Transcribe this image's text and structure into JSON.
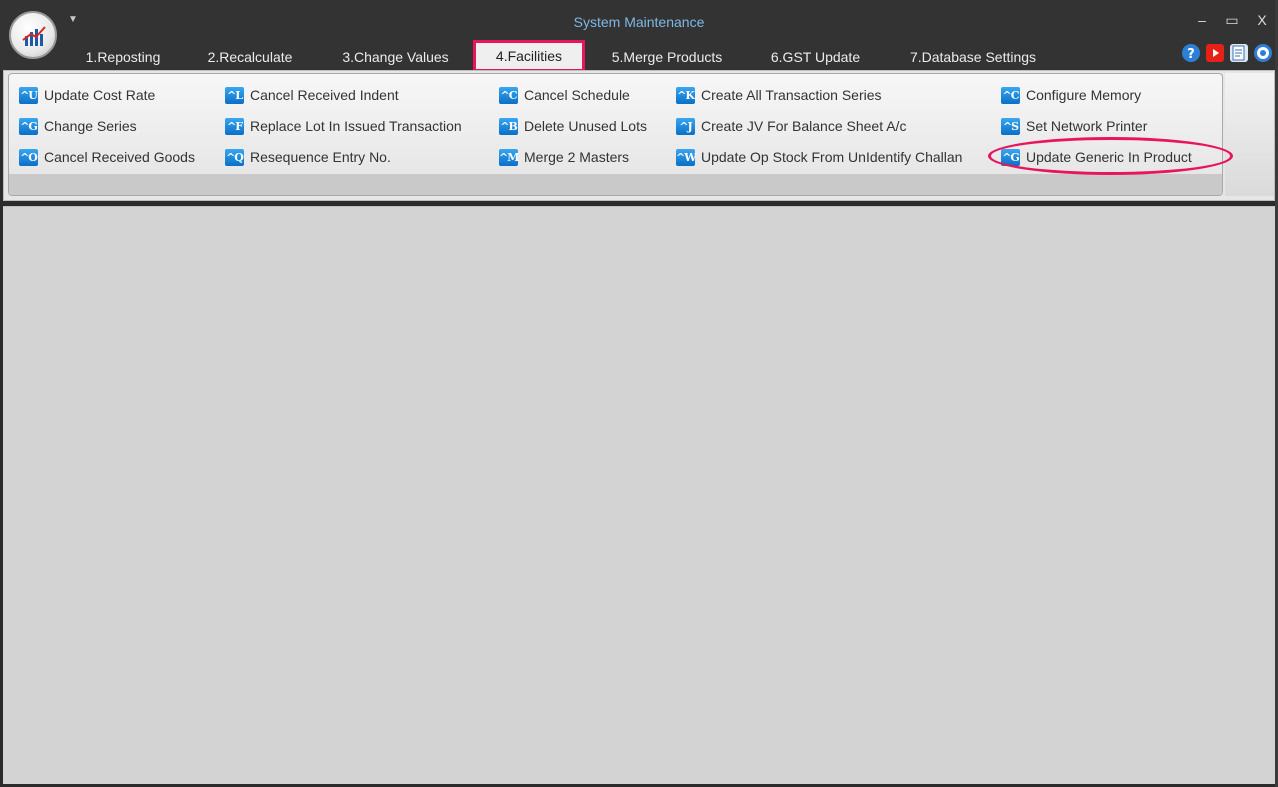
{
  "window": {
    "title": "System Maintenance"
  },
  "window_controls": {
    "minimize": "–",
    "maximize": "▭",
    "close": "X"
  },
  "tabs": [
    {
      "label": "1.Reposting"
    },
    {
      "label": "2.Recalculate"
    },
    {
      "label": "3.Change Values"
    },
    {
      "label": "4.Facilities"
    },
    {
      "label": "5.Merge Products"
    },
    {
      "label": "6.GST Update"
    },
    {
      "label": "7.Database Settings"
    }
  ],
  "active_tab": "4.Facilities",
  "ribbon": {
    "col1": [
      {
        "key": "^U",
        "label": "Update Cost Rate"
      },
      {
        "key": "^G",
        "label": "Change Series"
      },
      {
        "key": "^O",
        "label": "Cancel Received Goods"
      }
    ],
    "col2": [
      {
        "key": "^L",
        "label": "Cancel Received Indent"
      },
      {
        "key": "^F",
        "label": "Replace Lot In Issued Transaction"
      },
      {
        "key": "^Q",
        "label": "Resequence Entry No."
      }
    ],
    "col3": [
      {
        "key": "^C",
        "label": "Cancel Schedule"
      },
      {
        "key": "^B",
        "label": "Delete Unused Lots"
      },
      {
        "key": "^M",
        "label": "Merge 2 Masters"
      }
    ],
    "col4": [
      {
        "key": "^K",
        "label": "Create All Transaction Series"
      },
      {
        "key": "^J",
        "label": "Create JV For Balance Sheet A/c"
      },
      {
        "key": "^W",
        "label": "Update Op Stock From UnIdentify Challan"
      }
    ],
    "col5": [
      {
        "key": "^C",
        "label": "Configure Memory"
      },
      {
        "key": "^S",
        "label": "Set Network Printer"
      },
      {
        "key": "^G",
        "label": "Update Generic In Product"
      }
    ]
  },
  "colors": {
    "accent_highlight": "#e8155b",
    "icon_blue": "#0a6fc8",
    "title_text": "#7fb8e6"
  },
  "icons": [
    "app-logo",
    "help-icon",
    "youtube-icon",
    "notes-icon",
    "info-icon"
  ]
}
